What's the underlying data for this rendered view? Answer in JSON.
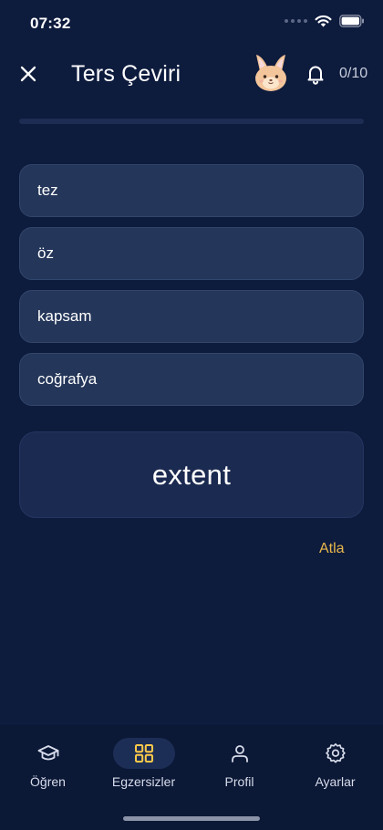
{
  "status_bar": {
    "time": "07:32"
  },
  "header": {
    "title": "Ters Çeviri",
    "counter": "0/10"
  },
  "progress": {
    "fraction": 0
  },
  "options": [
    {
      "label": "tez"
    },
    {
      "label": "öz"
    },
    {
      "label": "kapsam"
    },
    {
      "label": "coğrafya"
    }
  ],
  "prompt_word": "extent",
  "skip_label": "Atla",
  "nav": {
    "items": [
      {
        "label": "Öğren",
        "icon": "graduation-cap-icon",
        "active": false
      },
      {
        "label": "Egzersizler",
        "icon": "grid-icon",
        "active": true
      },
      {
        "label": "Profil",
        "icon": "person-icon",
        "active": false
      },
      {
        "label": "Ayarlar",
        "icon": "gear-icon",
        "active": false
      }
    ]
  },
  "colors": {
    "background": "#0d1b3d",
    "option_bg": "#243659",
    "accent": "#e9b84a",
    "active_nav_bg": "#1d2e56"
  }
}
